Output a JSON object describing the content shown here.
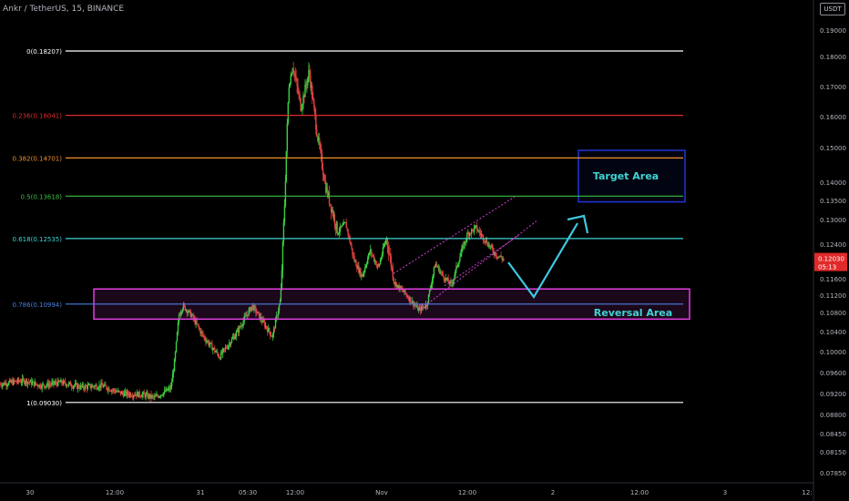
{
  "header": {
    "title": "Ankr / TetherUS, 15, BINANCE",
    "currency_badge": "USDT"
  },
  "chart_data": {
    "type": "candlestick",
    "symbol": "Ankr / TetherUS",
    "interval": "15",
    "exchange": "BINANCE",
    "ylim": [
      0.0762,
      0.1985
    ],
    "y_ticks": [
      "0.19000",
      "0.18000",
      "0.17000",
      "0.16000",
      "0.15000",
      "0.14000",
      "0.13500",
      "0.13000",
      "0.12400",
      "0.11600",
      "0.11200",
      "0.10800",
      "0.10400",
      "0.10000",
      "0.09600",
      "0.09200",
      "0.08800",
      "0.08450",
      "0.08150",
      "0.07850"
    ],
    "x_ticks": [
      "30",
      "12:00",
      "31",
      "05:30",
      "12:00",
      "Nov",
      "12:00",
      "2",
      "12:00",
      "3",
      "12:"
    ],
    "current_price": "0.12030",
    "countdown": "05:13",
    "price_path": [
      [
        0.0,
        0.0938
      ],
      [
        0.06,
        0.0945
      ],
      [
        0.1,
        0.0935
      ],
      [
        0.15,
        0.0941
      ],
      [
        0.2,
        0.0932
      ],
      [
        0.25,
        0.0935
      ],
      [
        0.3,
        0.092
      ],
      [
        0.35,
        0.0918
      ],
      [
        0.38,
        0.0912
      ],
      [
        0.42,
        0.093
      ],
      [
        0.43,
        0.0985
      ],
      [
        0.44,
        0.1075
      ],
      [
        0.45,
        0.1095
      ],
      [
        0.47,
        0.1075
      ],
      [
        0.5,
        0.103
      ],
      [
        0.54,
        0.099
      ],
      [
        0.58,
        0.1035
      ],
      [
        0.62,
        0.1095
      ],
      [
        0.65,
        0.1055
      ],
      [
        0.67,
        0.103
      ],
      [
        0.69,
        0.111
      ],
      [
        0.7,
        0.135
      ],
      [
        0.71,
        0.17
      ],
      [
        0.72,
        0.177
      ],
      [
        0.74,
        0.163
      ],
      [
        0.76,
        0.175
      ],
      [
        0.78,
        0.154
      ],
      [
        0.8,
        0.139
      ],
      [
        0.83,
        0.127
      ],
      [
        0.85,
        0.129
      ],
      [
        0.87,
        0.1205
      ],
      [
        0.89,
        0.1165
      ],
      [
        0.91,
        0.1225
      ],
      [
        0.93,
        0.1185
      ],
      [
        0.95,
        0.1255
      ],
      [
        0.97,
        0.115
      ],
      [
        1.0,
        0.112
      ],
      [
        1.03,
        0.1085
      ],
      [
        1.05,
        0.11
      ],
      [
        1.07,
        0.1195
      ],
      [
        1.09,
        0.1165
      ],
      [
        1.11,
        0.1145
      ],
      [
        1.13,
        0.121
      ],
      [
        1.15,
        0.1265
      ],
      [
        1.17,
        0.128
      ],
      [
        1.2,
        0.124
      ],
      [
        1.22,
        0.1215
      ],
      [
        1.24,
        0.1205
      ]
    ],
    "x_range": [
      0.0,
      2.0
    ],
    "fib_levels": [
      {
        "ratio": 0,
        "label": "0(0.18207)",
        "value": 0.18207,
        "color": "#ffffff"
      },
      {
        "ratio": 0.236,
        "label": "0.236(0.16041)",
        "value": 0.16041,
        "color": "#e02a2a"
      },
      {
        "ratio": 0.382,
        "label": "0.382(0.14701)",
        "value": 0.14701,
        "color": "#f0902a"
      },
      {
        "ratio": 0.5,
        "label": "0.5(0.13618)",
        "value": 0.13618,
        "color": "#38c040"
      },
      {
        "ratio": 0.618,
        "label": "0.618(0.12535)",
        "value": 0.12535,
        "color": "#3fd4d4"
      },
      {
        "ratio": 0.786,
        "label": "0.786(0.10994)",
        "value": 0.10994,
        "color": "#4a7fe0"
      },
      {
        "ratio": 1,
        "label": "1(0.09030)",
        "value": 0.0903,
        "color": "#ffffff"
      }
    ],
    "annotations": [
      {
        "text": "Target Area",
        "color": "#3fd4d4"
      },
      {
        "text": "Reversal Area",
        "color": "#3fd4d4"
      }
    ],
    "colors": {
      "background": "#000000",
      "up": "#38d040",
      "down": "#e04040",
      "price_label_bg": "#e02a2a",
      "axis_text": "#b2b5be",
      "target_box": "#2034d8",
      "reversal_box": "#e040e0",
      "arrow": "#3fc8e0",
      "channel": "#d040d0"
    }
  }
}
